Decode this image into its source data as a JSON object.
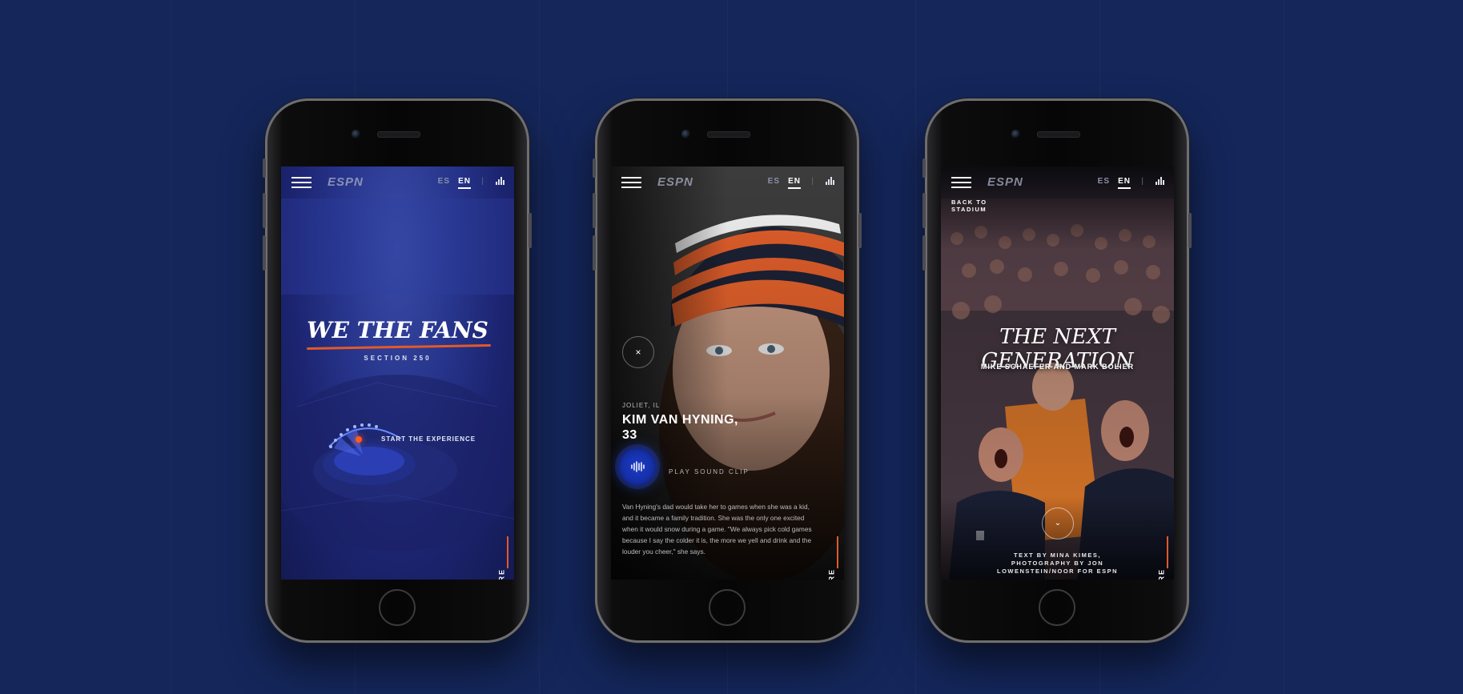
{
  "nav": {
    "logo": "ESPN",
    "lang_es": "ES",
    "lang_en": "EN",
    "lang_sep": "|",
    "share": "SHARE"
  },
  "screen1": {
    "title": "WE THE FANS",
    "subtitle": "SECTION 250",
    "cta": "START THE EXPERIENCE"
  },
  "screen2": {
    "location": "JOLIET, IL",
    "name": "KIM VAN HYNING, 33",
    "close_glyph": "×",
    "sound_label": "PLAY SOUND CLIP",
    "quote": "Van Hyning's dad would take her to games when she was a kid, and it became a family tradition. She was the only one excited when it would snow during a game. \"We always pick cold games because I say the colder it is, the more we yell and drink and the louder you cheer,\" she says."
  },
  "screen3": {
    "back": "BACK TO STADIUM",
    "title": "THE NEXT GENERATION",
    "names": "MIKE SCHAEFER AND MARK BOLIER",
    "chevron_glyph": "⌄",
    "credit": "TEXT BY MINA KIMES, PHOTOGRAPHY BY JON LOWENSTEIN/NOOR FOR ESPN"
  },
  "colors": {
    "background": "#14265a",
    "accent": "#e3592a",
    "sound_button": "#1d3cc9"
  }
}
